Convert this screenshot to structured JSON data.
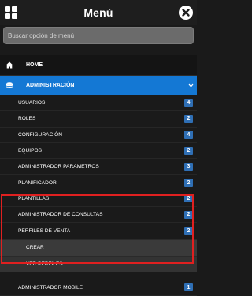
{
  "header": {
    "title": "Menú",
    "grid_icon": "grid-icon",
    "close_icon": "close-icon"
  },
  "search": {
    "placeholder": "Buscar opción de menú",
    "value": ""
  },
  "home": {
    "label": "HOME",
    "icon": "home-icon"
  },
  "admin": {
    "label": "ADMINISTRACIÓN",
    "icon": "database-icon",
    "expanded": true
  },
  "items": [
    {
      "label": "USUARIOS",
      "count": "4"
    },
    {
      "label": "ROLES",
      "count": "2"
    },
    {
      "label": "CONFIGURACIÓN",
      "count": "4"
    },
    {
      "label": "EQUIPOS",
      "count": "2"
    },
    {
      "label": "ADMINISTRADOR PARAMETROS",
      "count": "3"
    },
    {
      "label": "PLANIFICADOR",
      "count": "2"
    },
    {
      "label": "PLANTILLAS",
      "count": "2"
    },
    {
      "label": "ADMINISTRADOR DE CONSULTAS",
      "count": "2"
    },
    {
      "label": "PERFILES DE VENTA",
      "count": "2"
    }
  ],
  "perfiles_sub": [
    {
      "label": "CREAR"
    },
    {
      "label": "VER PERFILES"
    }
  ],
  "last_item": {
    "label": "ADMINISTRADOR MOBILE",
    "count": "1"
  },
  "colors": {
    "accent": "#1478d4",
    "badge": "#2f6fb5",
    "highlight": "#e02020",
    "background": "#1a1a1a"
  }
}
